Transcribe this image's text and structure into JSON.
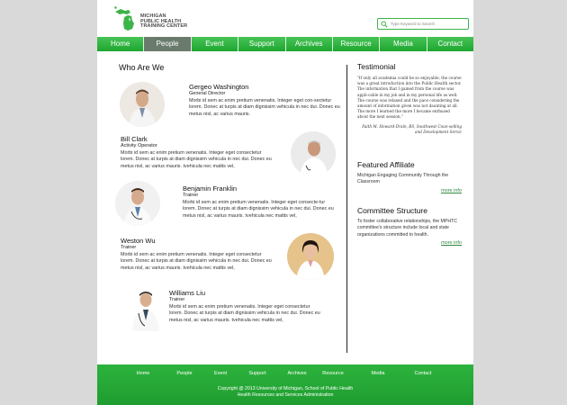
{
  "brand": {
    "line1": "MICHIGAN",
    "line2": "PUBLIC HEALTH",
    "line3": "TRAINING CENTER",
    "color": "#3cb449"
  },
  "search": {
    "placeholder": "Type Keyword to Search",
    "icon": "search-icon"
  },
  "nav": {
    "items": [
      "Home",
      "People",
      "Event",
      "Support",
      "Archives",
      "Resource",
      "Media",
      "Contact"
    ],
    "active": "People"
  },
  "main": {
    "heading": "Who Are We",
    "people": [
      {
        "name": "Gergeo Washington",
        "role": "General Director",
        "bio": "Morbi id sem ac enim pretium venenatis. Integer eget con-sectetur lorem. Donec at turpis at diam dignissim vehicula in nec dui. Donec eu metus nisl, ac varius mauris."
      },
      {
        "name": "Bill Clark",
        "role": "Activity Operator",
        "bio": "Morbi id sem ac enim pretium venenatis. Integer eget consectetur lorem. Donec at turpis at diam dignissim vehicula in nec dui. Donec eu metus nisl, ac varius mauris.  tvehicula nec mattis vel,"
      },
      {
        "name": "Benjamin Franklin",
        "role": "Trainer",
        "bio": "Morbi id sem ac enim pretium venenatis. Integer eget consecte-tur lorem. Donec at turpis at diam dignissim vehicula in nec dui. Donec eu metus nisl, ac varius mauris.  tvehicula nec mattis vel,"
      },
      {
        "name": "Weston Wu",
        "role": "Trainer",
        "bio": "Morbi id sem ac enim pretium venenatis. Integer eget consectetur lorem. Donec at turpis at diam dignissim vehicula in nec dui. Donec eu metus nisl, ac varius mauris.  tvehicula nec mattis vel,"
      },
      {
        "name": "Williams Liu",
        "role": "Trainer",
        "bio": "Morbi id sem ac enim pretium venenatis. Integer eget consectetur lorem. Donec at turpis at diam dignissim vehicula in nec dui. Donec eu metus nisl, ac varius mauris.  tvehicula nec mattis vel,"
      }
    ]
  },
  "sidebar": {
    "testimonial": {
      "heading": "Testimonial",
      "quote": "\"If only all academia could be so enjoyable, the course was a great introduction into the Public Health sector. The information that I gained from the course was appli-cable in my job and in my personal life as well. The course was relaxed and the pace considering the amount of information given was not daunting at all. The more I learned the more I became enthused about the next session.\"",
      "attribution": "Faith M. Howard-Drain, BS, Southwest Coun-selling and Development Servic"
    },
    "featured": {
      "heading": "Featured Affiliate",
      "text": "Michigan Engaging Community Through the Classroom",
      "more": "more info"
    },
    "committee": {
      "heading": "Committee Structure",
      "text": "To foster collaborative relationships, the MPHTC committee's structure include local and state organizations committed to health.",
      "more": "more info"
    }
  },
  "footer": {
    "nav": [
      "Home",
      "People",
      "Event",
      "Support",
      "Archives",
      "Resource",
      "Media",
      "Contact"
    ],
    "copyright_line1": "Copyright @ 2013 University of Michigan, School of Public Health",
    "copyright_line2": "Health Resources and Services Administration"
  }
}
